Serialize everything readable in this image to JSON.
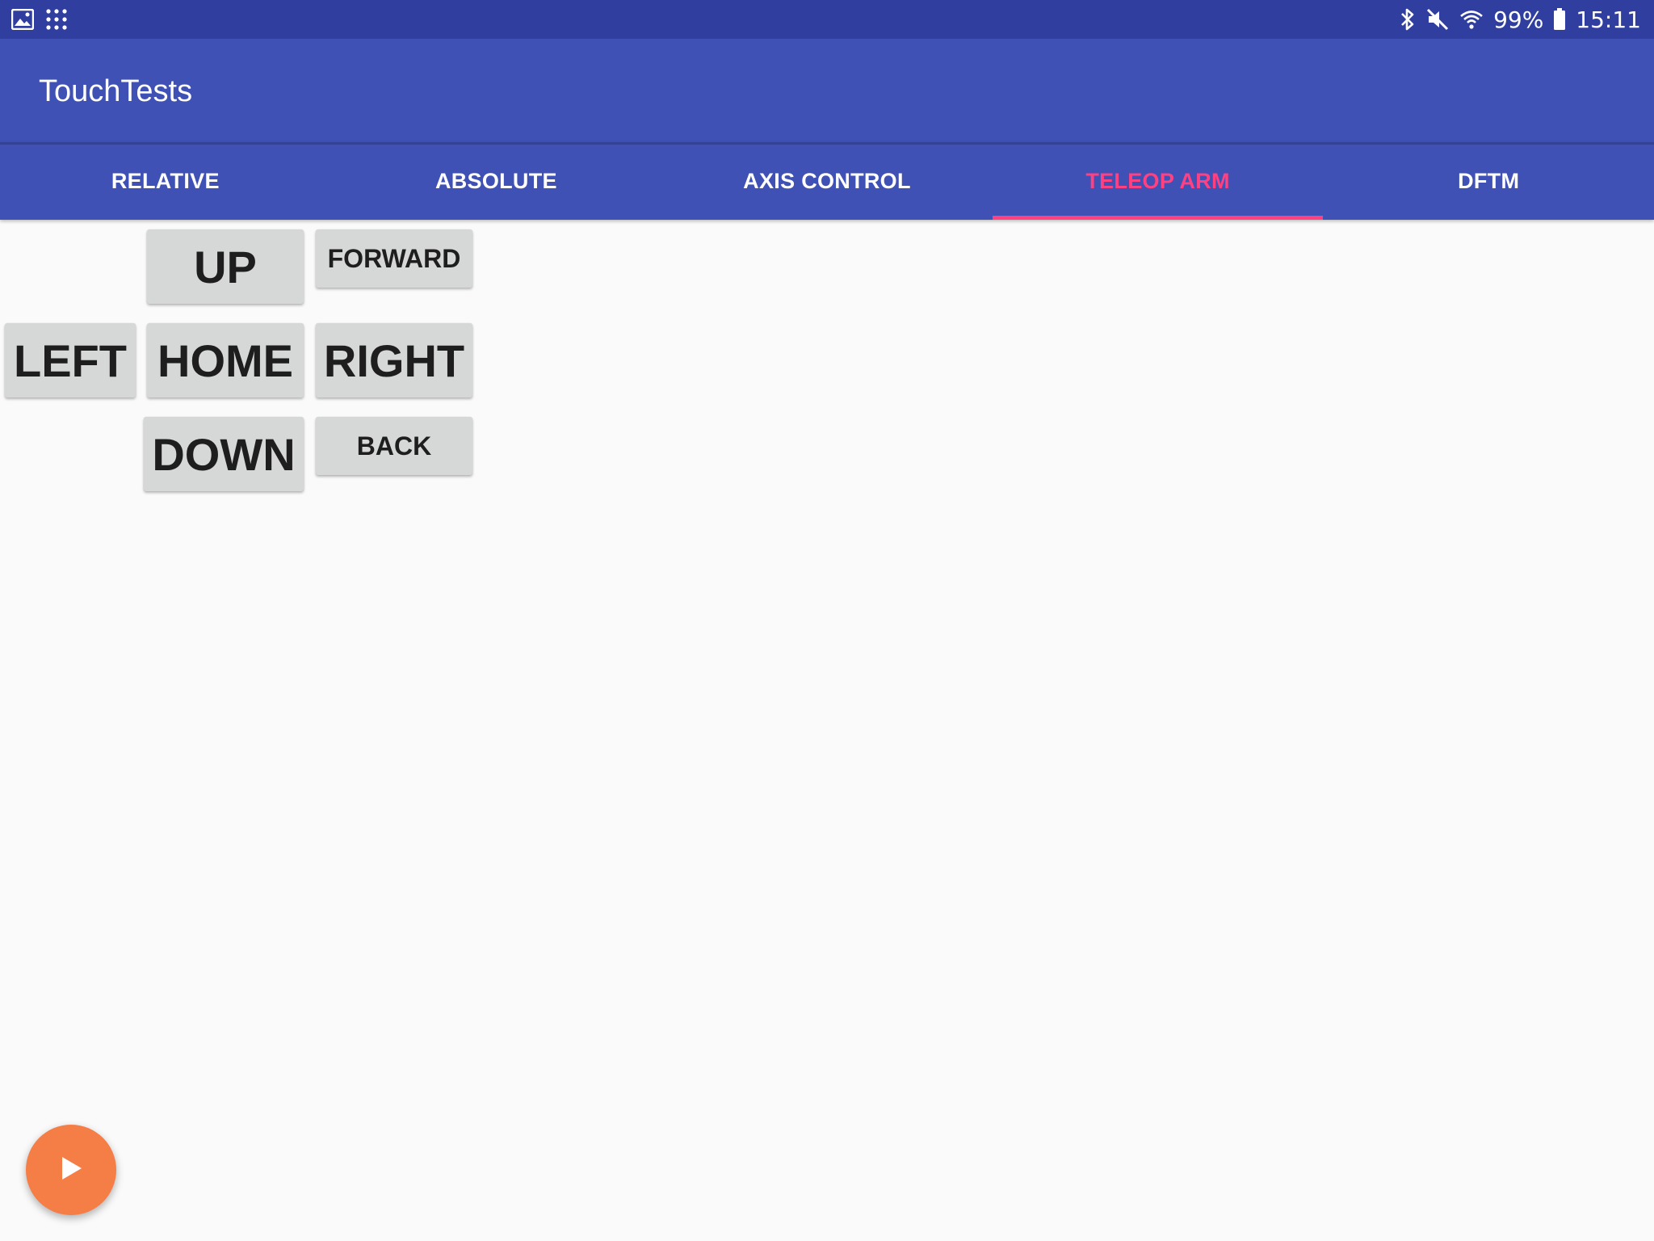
{
  "status_bar": {
    "icons_left": [
      "gallery-icon",
      "apps-grid-icon"
    ],
    "icons_right": [
      "bluetooth-icon",
      "mute-icon",
      "wifi-icon"
    ],
    "battery": "99%",
    "time": "15:11"
  },
  "app_bar": {
    "title": "TouchTests"
  },
  "tabs": [
    {
      "label": "RELATIVE",
      "active": false
    },
    {
      "label": "ABSOLUTE",
      "active": false
    },
    {
      "label": "AXIS CONTROL",
      "active": false
    },
    {
      "label": "TELEOP ARM",
      "active": true
    },
    {
      "label": "DFTM",
      "active": false
    }
  ],
  "controls": {
    "up": "UP",
    "forward": "FORWARD",
    "left": "LEFT",
    "home": "HOME",
    "right": "RIGHT",
    "down": "DOWN",
    "back": "BACK"
  },
  "fab": {
    "icon": "play-icon"
  },
  "colors": {
    "status_bar": "#303f9f",
    "primary": "#3f51b5",
    "accent": "#ff4081",
    "fab": "#f57d46",
    "button": "#d6d7d7",
    "background": "#fafafa"
  }
}
